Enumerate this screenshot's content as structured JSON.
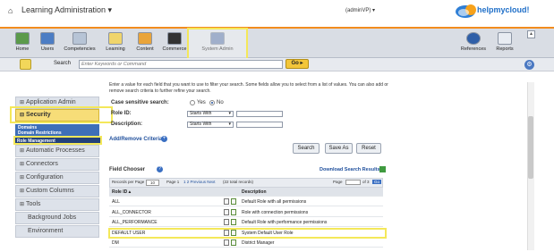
{
  "header": {
    "home_glyph": "⌂",
    "app_title": "Learning Administration ▾",
    "user_menu": "(adminVP) ▾",
    "logo_text": "helpmycloud!"
  },
  "toolbar": {
    "items": [
      {
        "label": "Home",
        "icon": "home-icon"
      },
      {
        "label": "Users",
        "icon": "users-icon"
      },
      {
        "label": "Competencies",
        "icon": "competencies-icon"
      },
      {
        "label": "Learning",
        "icon": "learning-icon"
      },
      {
        "label": "Content",
        "icon": "content-icon"
      },
      {
        "label": "Commerce",
        "icon": "commerce-icon"
      },
      {
        "label": "System Admin",
        "icon": "system-admin-icon"
      },
      {
        "label": "References",
        "icon": "info-icon"
      },
      {
        "label": "Reports",
        "icon": "reports-icon"
      }
    ],
    "close_glyph": "▴"
  },
  "search": {
    "label": "Search",
    "placeholder": "Enter Keywords or Command",
    "go_label": "Go ▸",
    "settings_glyph": "⚙"
  },
  "sidebar": {
    "items": [
      {
        "label": "Application Admin",
        "expander": "⊞"
      },
      {
        "label": "Security",
        "expander": "⊟"
      },
      {
        "label": "Automatic Processes",
        "expander": "⊞"
      },
      {
        "label": "Connectors",
        "expander": "⊞"
      },
      {
        "label": "Configuration",
        "expander": "⊞"
      },
      {
        "label": "Custom Columns",
        "expander": "⊞"
      },
      {
        "label": "Tools",
        "expander": "⊞"
      },
      {
        "label": "Background Jobs",
        "expander": ""
      },
      {
        "label": "Environment",
        "expander": ""
      }
    ],
    "security_sub": [
      "Domains",
      "Domain Restrictions",
      "Role Management"
    ]
  },
  "form": {
    "instructions": "Enter a value for each field that you want to use to filter your search. Some fields allow you to select from a list of values. You can also add or remove search criteria to further refine your search.",
    "case_label": "Case sensitive search:",
    "yes_label": "Yes",
    "no_label": "No",
    "roleid_label": "Role ID:",
    "roleid_op": "Starts With",
    "desc_label": "Description:",
    "desc_op": "Starts With",
    "add_remove_label": "Add/Remove Criteria",
    "search_btn": "Search",
    "saveas_btn": "Save As",
    "reset_btn": "Reset"
  },
  "results": {
    "field_chooser": "Field Chooser",
    "download_label": "Download Search Results",
    "pager": {
      "records_label": "Records per Page",
      "records_value": "10",
      "page_label": "Page 1",
      "nav": "1 2 Previous Next",
      "total": "(22 total records)",
      "page_field_label": "Page",
      "of_label": "of 3",
      "go_label": "Go"
    },
    "columns": [
      "Role ID ▴",
      "",
      "Description"
    ],
    "rows": [
      {
        "id": "ALL",
        "desc": "Default Role with all permissions"
      },
      {
        "id": "ALL_CONNECTOR",
        "desc": "Role with connection permissions"
      },
      {
        "id": "ALL_PERFORMANCE",
        "desc": "Default Role with performance permissions"
      },
      {
        "id": "DEFAULT USER",
        "desc": "System Default User Role"
      },
      {
        "id": "DM",
        "desc": "District Manager"
      }
    ]
  }
}
